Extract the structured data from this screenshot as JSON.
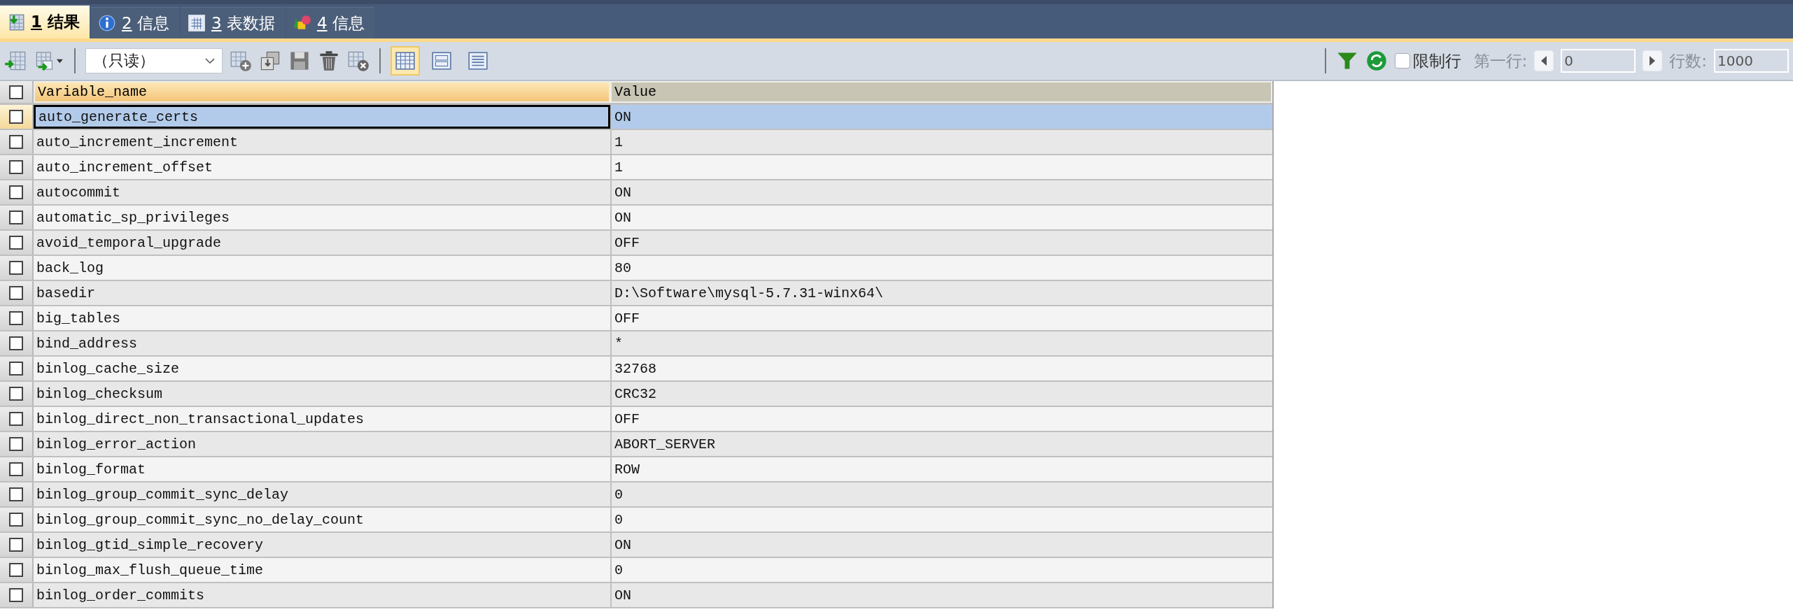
{
  "tabs": [
    {
      "key": "1",
      "label": "结果",
      "kind": "result",
      "selected": true
    },
    {
      "key": "2",
      "label": "信息",
      "kind": "message",
      "selected": false
    },
    {
      "key": "3",
      "label": "表数据",
      "kind": "table-data",
      "selected": false
    },
    {
      "key": "4",
      "label": "信息",
      "kind": "profile",
      "selected": false
    }
  ],
  "toolbar": {
    "mode_select": {
      "value": "（只读）"
    },
    "view_modes": [
      {
        "kind": "grid",
        "selected": true
      },
      {
        "kind": "form",
        "selected": false
      },
      {
        "kind": "text",
        "selected": false
      }
    ],
    "limit_rows": {
      "label": "限制行",
      "checked": false
    },
    "paging": {
      "disabled": true,
      "first_row_label": "第一行:",
      "first_row_value": "0",
      "row_count_label": "行数:",
      "row_count_value": "1000"
    }
  },
  "table": {
    "select_all": {
      "checked": false
    },
    "columns": [
      {
        "label": "Variable_name",
        "selected": true
      },
      {
        "label": "Value",
        "selected": false
      }
    ],
    "rows": [
      {
        "name": "auto_generate_certs",
        "value": "ON",
        "selected": true
      },
      {
        "name": "auto_increment_increment",
        "value": "1",
        "selected": false
      },
      {
        "name": "auto_increment_offset",
        "value": "1",
        "selected": false
      },
      {
        "name": "autocommit",
        "value": "ON",
        "selected": false
      },
      {
        "name": "automatic_sp_privileges",
        "value": "ON",
        "selected": false
      },
      {
        "name": "avoid_temporal_upgrade",
        "value": "OFF",
        "selected": false
      },
      {
        "name": "back_log",
        "value": "80",
        "selected": false
      },
      {
        "name": "basedir",
        "value": "D:\\Software\\mysql-5.7.31-winx64\\",
        "selected": false
      },
      {
        "name": "big_tables",
        "value": "OFF",
        "selected": false
      },
      {
        "name": "bind_address",
        "value": "*",
        "selected": false
      },
      {
        "name": "binlog_cache_size",
        "value": "32768",
        "selected": false
      },
      {
        "name": "binlog_checksum",
        "value": "CRC32",
        "selected": false
      },
      {
        "name": "binlog_direct_non_transactional_updates",
        "value": "OFF",
        "selected": false
      },
      {
        "name": "binlog_error_action",
        "value": "ABORT_SERVER",
        "selected": false
      },
      {
        "name": "binlog_format",
        "value": "ROW",
        "selected": false
      },
      {
        "name": "binlog_group_commit_sync_delay",
        "value": "0",
        "selected": false
      },
      {
        "name": "binlog_group_commit_sync_no_delay_count",
        "value": "0",
        "selected": false
      },
      {
        "name": "binlog_gtid_simple_recovery",
        "value": "ON",
        "selected": false
      },
      {
        "name": "binlog_max_flush_queue_time",
        "value": "0",
        "selected": false
      },
      {
        "name": "binlog_order_commits",
        "value": "ON",
        "selected": false
      }
    ]
  }
}
